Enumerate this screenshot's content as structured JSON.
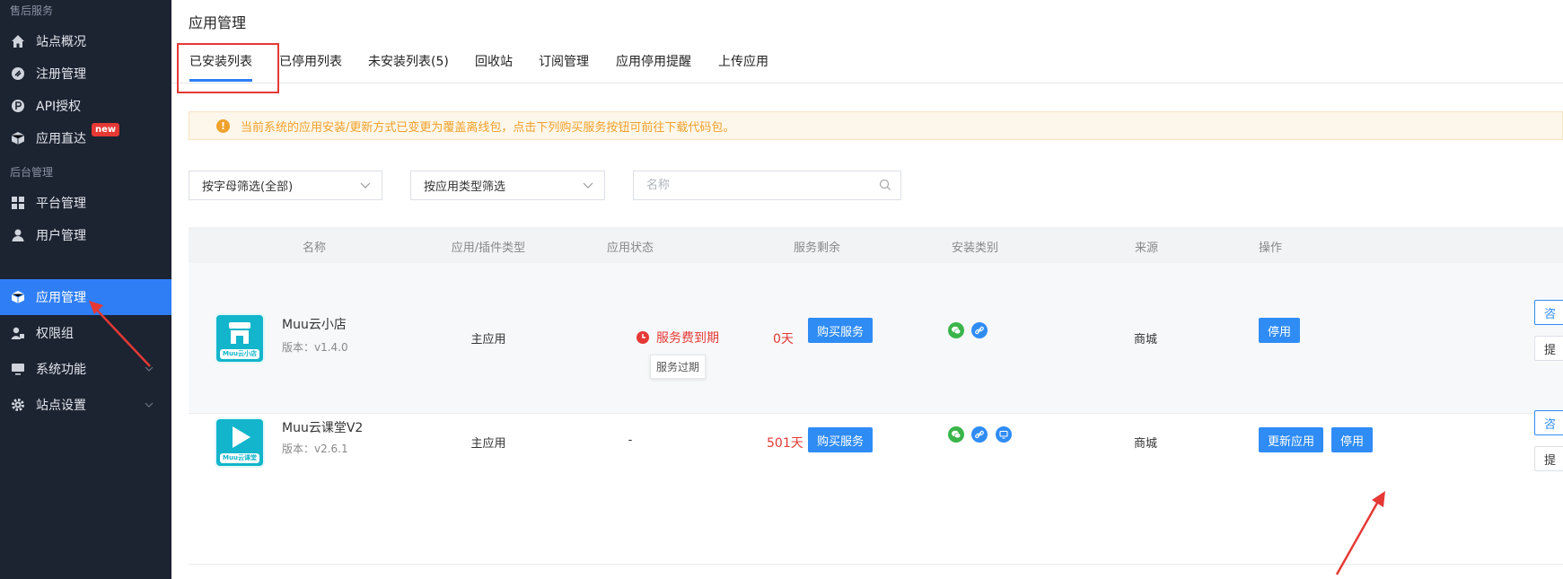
{
  "sidebar": {
    "sections": [
      {
        "label": "售后服务"
      },
      {
        "label": "后台管理"
      }
    ],
    "items": [
      {
        "label": "站点概况",
        "icon": "home-icon"
      },
      {
        "label": "注册管理",
        "icon": "register-icon"
      },
      {
        "label": "API授权",
        "icon": "api-icon"
      },
      {
        "label": "应用直达",
        "icon": "box-icon",
        "badge": "new"
      },
      {
        "label": "平台管理",
        "icon": "grid-icon"
      },
      {
        "label": "用户管理",
        "icon": "user-icon"
      },
      {
        "label": "应用管理",
        "icon": "cube-icon",
        "active": true
      },
      {
        "label": "权限组",
        "icon": "permission-icon"
      },
      {
        "label": "系统功能",
        "icon": "monitor-icon"
      },
      {
        "label": "站点设置",
        "icon": "gear-icon"
      }
    ]
  },
  "header": {
    "title": "应用管理"
  },
  "tabs": [
    {
      "label": "已安装列表",
      "active": true
    },
    {
      "label": "已停用列表"
    },
    {
      "label": "未安装列表(5)"
    },
    {
      "label": "回收站"
    },
    {
      "label": "订阅管理"
    },
    {
      "label": "应用停用提醒"
    },
    {
      "label": "上传应用"
    }
  ],
  "notice": {
    "text": "当前系统的应用安装/更新方式已变更为覆盖离线包，点击下列购买服务按钮可前往下载代码包。",
    "icon": "!"
  },
  "filters": {
    "letter": "按字母筛选(全部)",
    "type": "按应用类型筛选",
    "search_placeholder": "名称"
  },
  "table": {
    "headers": [
      "名称",
      "应用/插件类型",
      "应用状态",
      "服务剩余",
      "安装类别",
      "来源",
      "操作"
    ],
    "rows": [
      {
        "name": "Muu云小店",
        "version": "版本：v1.4.0",
        "logo_caption": "Muu云小店",
        "type": "主应用",
        "status": "服务费到期",
        "status_tooltip": "服务过期",
        "remaining": "0天",
        "buy_label": "购买服务",
        "install_icons": [
          "wechat-icon",
          "link-icon"
        ],
        "source": "商城",
        "actions": [
          "停用"
        ],
        "edge_actions": [
          "咨",
          "提"
        ]
      },
      {
        "name": "Muu云课堂V2",
        "version": "版本：v2.6.1",
        "logo_caption": "Muu云课堂",
        "type": "主应用",
        "status": "-",
        "remaining": "501天",
        "buy_label": "购买服务",
        "install_icons": [
          "wechat-icon",
          "link-icon",
          "pc-icon"
        ],
        "source": "商城",
        "actions": [
          "更新应用",
          "停用"
        ],
        "edge_actions": [
          "咨",
          "提"
        ]
      }
    ]
  },
  "colors": {
    "accent": "#2f8cf5",
    "danger": "#e53935",
    "sidebar": "#1c2331",
    "warning": "#f0a12b"
  }
}
